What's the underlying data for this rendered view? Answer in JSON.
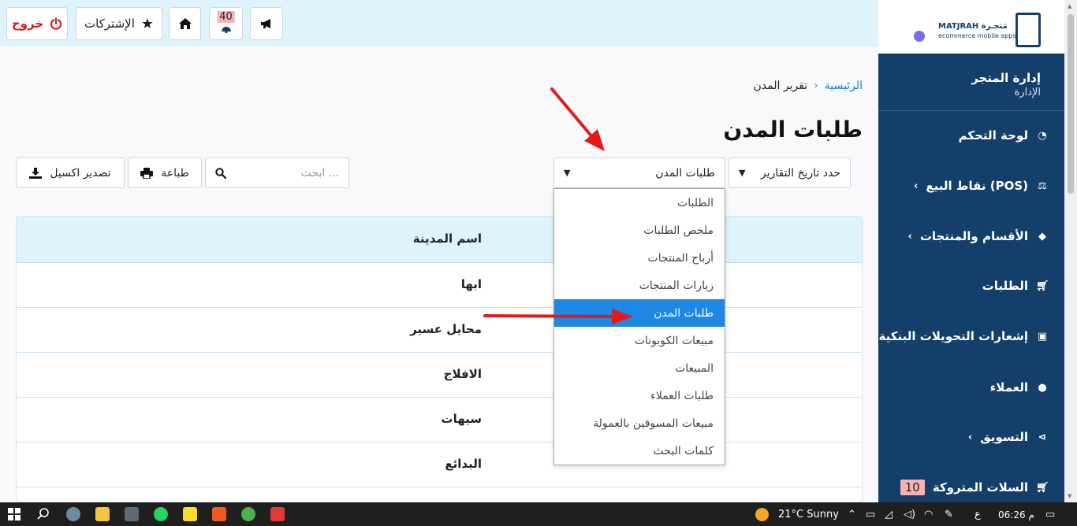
{
  "topbar": {
    "logout_label": "خروج",
    "subscriptions_label": "الإشتركات",
    "notification_count": "40"
  },
  "sidebar": {
    "logo_name": "MATJRAH",
    "logo_arabic": "مَتجـرة",
    "logo_tagline": "ecommerce mobile apps",
    "store_name": "إدارة المتجر",
    "store_role": "الإدارة",
    "items": [
      {
        "label": "لوحة التحكم",
        "icon": "dashboard-icon"
      },
      {
        "label": "نقاط البيع (POS)",
        "icon": "scale-icon",
        "has_submenu": true
      },
      {
        "label": "الأقسام والمنتجات",
        "icon": "tag-icon",
        "has_submenu": true
      },
      {
        "label": "الطلبات",
        "icon": "cart-icon"
      },
      {
        "label": "إشعارات التحويلات البنكية",
        "icon": "money-icon"
      },
      {
        "label": "العملاء",
        "icon": "user-icon"
      },
      {
        "label": "التسويق",
        "icon": "share-icon",
        "has_submenu": true
      },
      {
        "label": "السلات المتروكة",
        "icon": "cart-icon",
        "badge": "10"
      }
    ]
  },
  "breadcrumb": {
    "home": "الرئيسية",
    "current": "تقرير المدن"
  },
  "page_title": "طلبات المدن",
  "controls": {
    "date_select": "حدد تاريخ التقارير",
    "report_select": "طلبات المدن",
    "search_placeholder": "ابحث ...",
    "print_label": "طباعة",
    "export_label": "تصدير اكسيل"
  },
  "table": {
    "header": "اسم المدينة",
    "rows": [
      "ابها",
      "محايل عسير",
      "الافلاج",
      "سيهات",
      "البدائع"
    ]
  },
  "dropdown": {
    "options": [
      "الطلبات",
      "ملخص الطلبات",
      "أرباح المنتجات",
      "زيارات المنتجات",
      "طلبات المدن",
      "مبيعات الكوبونات",
      "المبيعات",
      "طلبات العملاء",
      "مبيعات المسوقين بالعمولة",
      "كلمات البحث"
    ],
    "selected": "طلبات المدن"
  },
  "taskbar": {
    "weather": "21°C  Sunny",
    "lang": "ع",
    "time": "06:26 م"
  }
}
